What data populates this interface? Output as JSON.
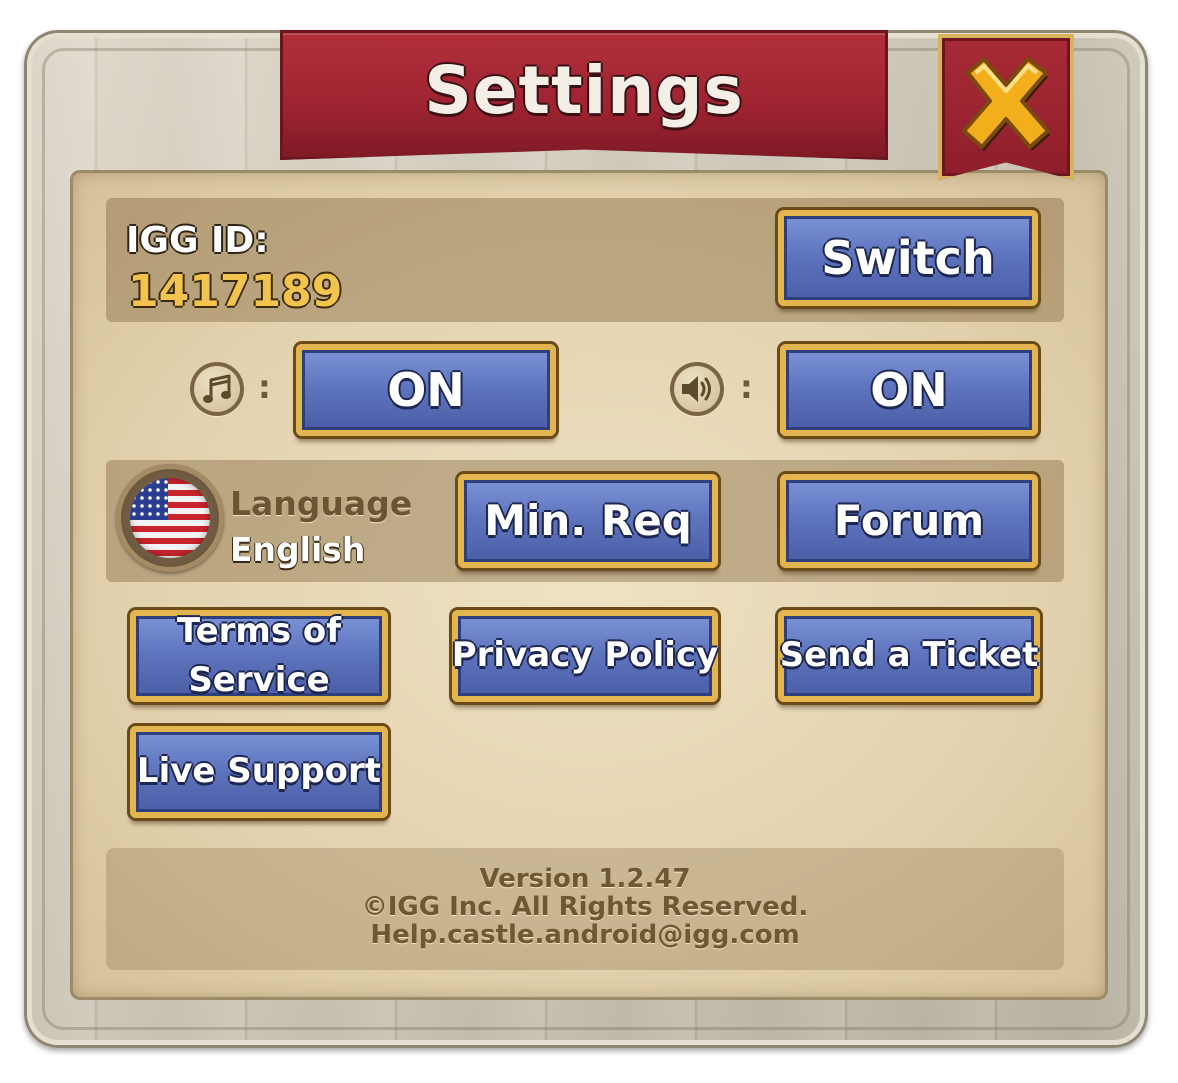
{
  "window": {
    "title": "Settings"
  },
  "header": {
    "close_icon": "close-x-icon"
  },
  "account": {
    "id_label": "IGG ID:",
    "id_value": "1417189",
    "switch_label": "Switch"
  },
  "audio": {
    "music_icon": "music-note-icon",
    "music_state": "ON",
    "sound_icon": "speaker-icon",
    "sound_state": "ON",
    "separator": ":"
  },
  "language": {
    "flag_icon": "us-flag-icon",
    "label": "Language",
    "value": "English",
    "min_req_label": "Min. Req",
    "forum_label": "Forum"
  },
  "links": {
    "terms_label": "Terms of Service",
    "privacy_label": "Privacy Policy",
    "ticket_label": "Send a Ticket",
    "support_label": "Live Support"
  },
  "footer": {
    "version": "Version 1.2.47",
    "copyright": "©IGG Inc. All Rights Reserved.",
    "email": "Help.castle.android@igg.com"
  },
  "colors": {
    "banner_red": "#9d2330",
    "button_blue": "#5f75be",
    "button_border_gold": "#e3b54e",
    "id_gold": "#f2c44d",
    "parchment": "#e3d2ae"
  }
}
